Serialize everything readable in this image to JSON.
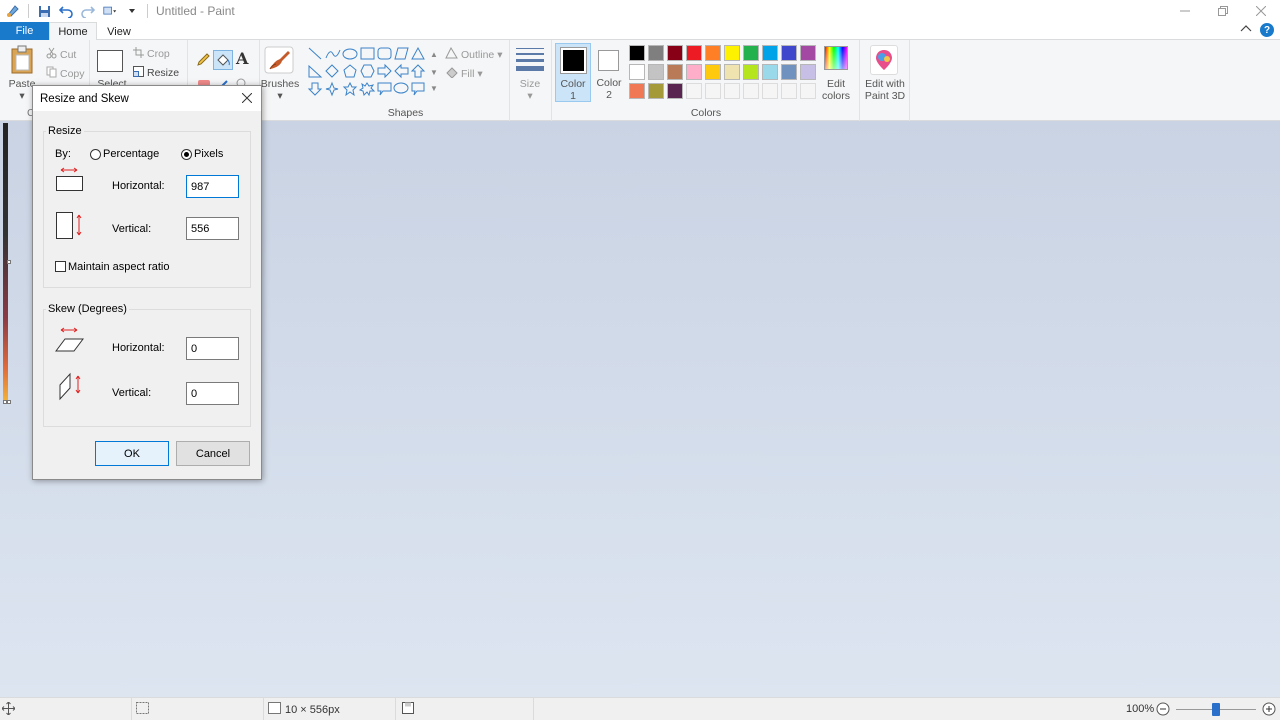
{
  "window": {
    "title": "Untitled - Paint"
  },
  "menu": {
    "file": "File",
    "home": "Home",
    "view": "View"
  },
  "ribbon": {
    "clipboard": {
      "paste": "Paste",
      "cut": "Cut",
      "copy": "Copy",
      "label_partial": "Cl"
    },
    "image": {
      "select": "Select",
      "crop": "Crop",
      "resize": "Resize"
    },
    "tools": {
      "brushes": "Brushes"
    },
    "shapes": {
      "outline": "Outline",
      "fill": "Fill",
      "label": "Shapes"
    },
    "size": {
      "label": "Size"
    },
    "color1": {
      "line1": "Color",
      "line2": "1"
    },
    "color2": {
      "line1": "Color",
      "line2": "2"
    },
    "colors": {
      "label": "Colors",
      "row1": [
        "#000000",
        "#7f7f7f",
        "#880015",
        "#ed1c24",
        "#ff7f27",
        "#fff200",
        "#22b14c",
        "#00a2e8",
        "#3f48cc",
        "#a349a4"
      ],
      "row2": [
        "#ffffff",
        "#c3c3c3",
        "#b97a57",
        "#ffaec9",
        "#ffc90e",
        "#efe4b0",
        "#b5e61d",
        "#99d9ea",
        "#7092be",
        "#c8bfe7"
      ],
      "row3": [
        "#f07855",
        "#a59a3a",
        "#5a2450",
        "#f5f5f5",
        "#f5f5f5",
        "#f5f5f5",
        "#f5f5f5",
        "#f5f5f5",
        "#f5f5f5",
        "#f5f5f5"
      ],
      "edit_line1": "Edit",
      "edit_line2": "colors"
    },
    "paint3d": {
      "line1": "Edit with",
      "line2": "Paint 3D"
    }
  },
  "dialog": {
    "title": "Resize and Skew",
    "resize": {
      "legend": "Resize",
      "by_label": "By:",
      "percentage_label": "Percentage",
      "pixels_label": "Pixels",
      "selected_mode": "Pixels",
      "horizontal_label": "Horizontal:",
      "horizontal_value": "987",
      "vertical_label": "Vertical:",
      "vertical_value": "556",
      "aspect_label": "Maintain aspect ratio",
      "aspect_checked": false
    },
    "skew": {
      "legend": "Skew (Degrees)",
      "horizontal_label": "Horizontal:",
      "horizontal_value": "0",
      "vertical_label": "Vertical:",
      "vertical_value": "0"
    },
    "ok": "OK",
    "cancel": "Cancel"
  },
  "status": {
    "size": "10 × 556px",
    "zoom": "100%",
    "zoom_level_percent": 100
  }
}
